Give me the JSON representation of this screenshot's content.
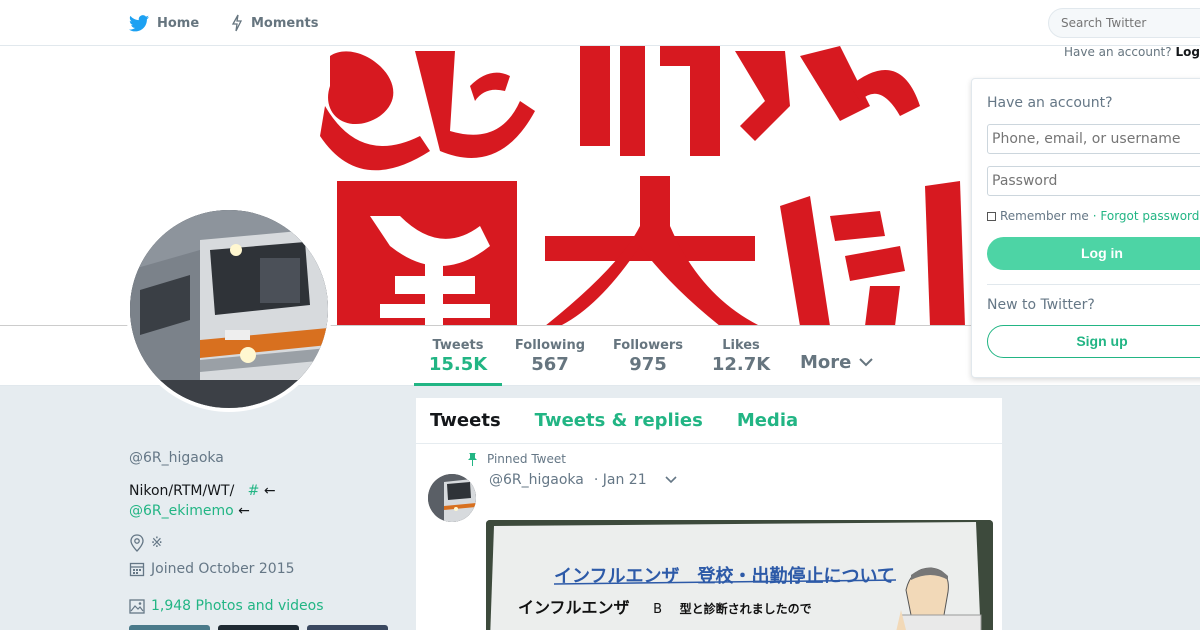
{
  "nav": {
    "home_label": "Home",
    "moments_label": "Moments",
    "search_placeholder": "Search Twitter",
    "have_account_text": "Have an account?",
    "login_link": "Log"
  },
  "profile": {
    "handle": "@6R_higaoka",
    "bio_line1": "Nikon/RTM/WT/",
    "bio_hash": "#",
    "bio_arrow": "←",
    "bio_link": "@6R_ekimemo",
    "bio_arrow2": "←",
    "location": "※",
    "joined": "Joined October 2015",
    "photos": "1,948 Photos and videos"
  },
  "stats": [
    {
      "label": "Tweets",
      "value": "15.5K"
    },
    {
      "label": "Following",
      "value": "567"
    },
    {
      "label": "Followers",
      "value": "975"
    },
    {
      "label": "Likes",
      "value": "12.7K"
    }
  ],
  "stats_more": "More",
  "timeline": {
    "tabs": [
      "Tweets",
      "Tweets & replies",
      "Media"
    ],
    "pinned_label": "Pinned Tweet",
    "tweet_handle": "@6R_higaoka",
    "tweet_date": "· Jan 21",
    "img_title": "インフルエンザ　登校・出勤停止について",
    "img_line2": "インフルエンザ",
    "img_b": "B",
    "img_line2b": "型と診断されましたので"
  },
  "login": {
    "title": "Have an account?",
    "phone_placeholder": "Phone, email, or username",
    "password_placeholder": "Password",
    "remember": "Remember me",
    "forgot": "· Forgot password?",
    "login_button": "Log in",
    "new_to": "New to Twitter?",
    "signup_button": "Sign up"
  },
  "colors": {
    "accent": "#22b584",
    "banner_red": "#d71920",
    "login_button": "#4dd4a5"
  }
}
